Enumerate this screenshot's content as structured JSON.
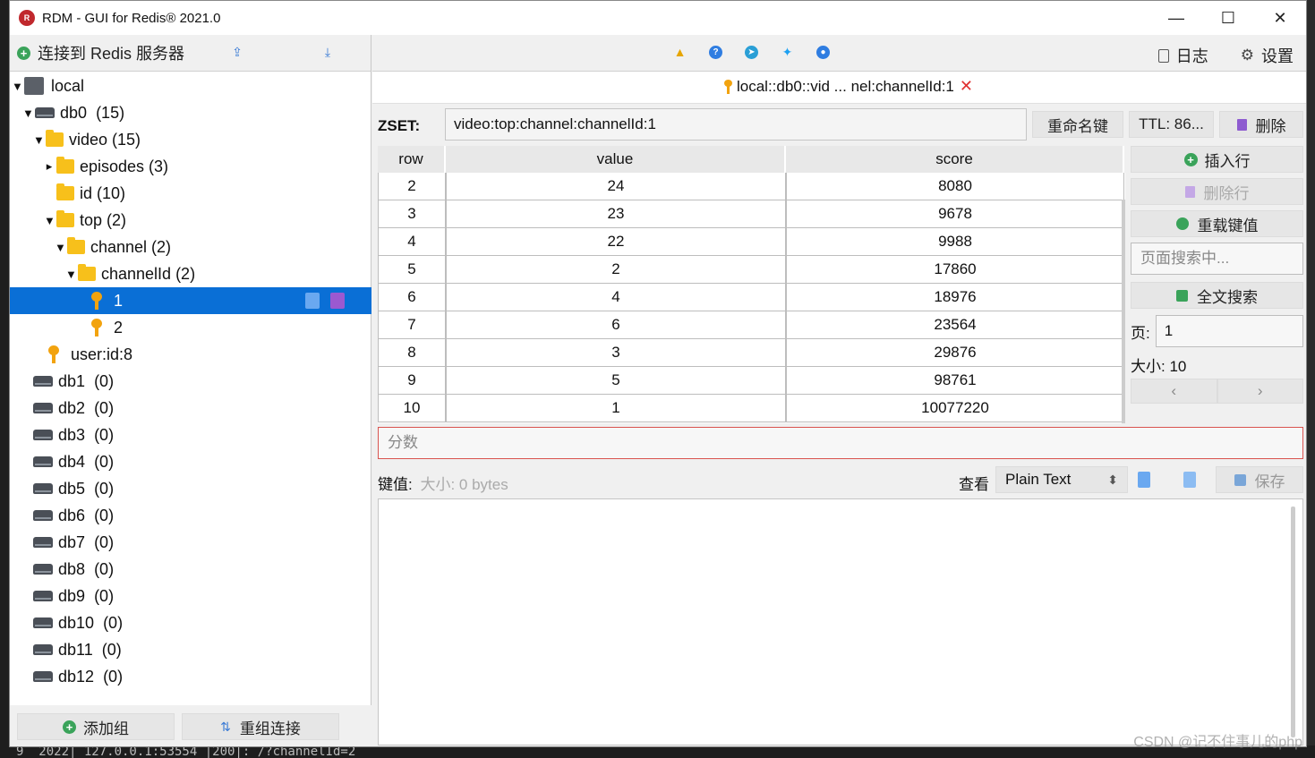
{
  "window": {
    "title": "RDM - GUI for Redis® 2021.0"
  },
  "left_toolbar": {
    "connect_label": "连接到 Redis 服务器"
  },
  "tree": {
    "server": "local",
    "db0": {
      "name": "db0",
      "count": "(15)"
    },
    "video": "video (15)",
    "episodes": "episodes (3)",
    "id": "id (10)",
    "top": "top (2)",
    "channel": "channel (2)",
    "channelId": "channelId (2)",
    "key1": "1",
    "key2": "2",
    "user_key": "user:id:8",
    "dbs": [
      {
        "name": "db1",
        "count": "(0)"
      },
      {
        "name": "db2",
        "count": "(0)"
      },
      {
        "name": "db3",
        "count": "(0)"
      },
      {
        "name": "db4",
        "count": "(0)"
      },
      {
        "name": "db5",
        "count": "(0)"
      },
      {
        "name": "db6",
        "count": "(0)"
      },
      {
        "name": "db7",
        "count": "(0)"
      },
      {
        "name": "db8",
        "count": "(0)"
      },
      {
        "name": "db9",
        "count": "(0)"
      },
      {
        "name": "db10",
        "count": "(0)"
      },
      {
        "name": "db11",
        "count": "(0)"
      },
      {
        "name": "db12",
        "count": "(0)"
      }
    ]
  },
  "left_bottom": {
    "add_group": "添加组",
    "reconnect": "重组连接"
  },
  "right_toolbar": {
    "log": "日志",
    "settings": "设置"
  },
  "tab": {
    "label": "local::db0::vid ... nel:channelId:1",
    "close": "✕"
  },
  "key": {
    "type": "ZSET:",
    "name": "video:top:channel:channelId:1",
    "rename": "重命名键",
    "ttl": "TTL:  86...",
    "delete": "删除"
  },
  "table": {
    "headers": [
      "row",
      "value",
      "score"
    ],
    "rows": [
      {
        "row": "2",
        "value": "24",
        "score": "8080"
      },
      {
        "row": "3",
        "value": "23",
        "score": "9678"
      },
      {
        "row": "4",
        "value": "22",
        "score": "9988"
      },
      {
        "row": "5",
        "value": "2",
        "score": "17860"
      },
      {
        "row": "6",
        "value": "4",
        "score": "18976"
      },
      {
        "row": "7",
        "value": "6",
        "score": "23564"
      },
      {
        "row": "8",
        "value": "3",
        "score": "29876"
      },
      {
        "row": "9",
        "value": "5",
        "score": "98761"
      },
      {
        "row": "10",
        "value": "1",
        "score": "10077220"
      }
    ],
    "overlay_label": "分数"
  },
  "side": {
    "insert_row": "插入行",
    "delete_row": "删除行",
    "reload": "重载键值",
    "search_placeholder": "页面搜索中...",
    "full_search": "全文搜索",
    "page_label": "页:",
    "page_value": "1",
    "size_label": "大小:",
    "size_value": "10",
    "prev": "‹",
    "next": "›"
  },
  "score_input": {
    "placeholder": "分数"
  },
  "value_bar": {
    "label": "键值:",
    "size": "大小:  0 bytes",
    "view_label": "查看",
    "format": "Plain Text",
    "save": "保存"
  },
  "terminal": {
    "bottom_line": "9  2022| 127.0.0.1:53554 |200|: /?channelId=2"
  },
  "watermark": "CSDN @记不住事儿的php"
}
